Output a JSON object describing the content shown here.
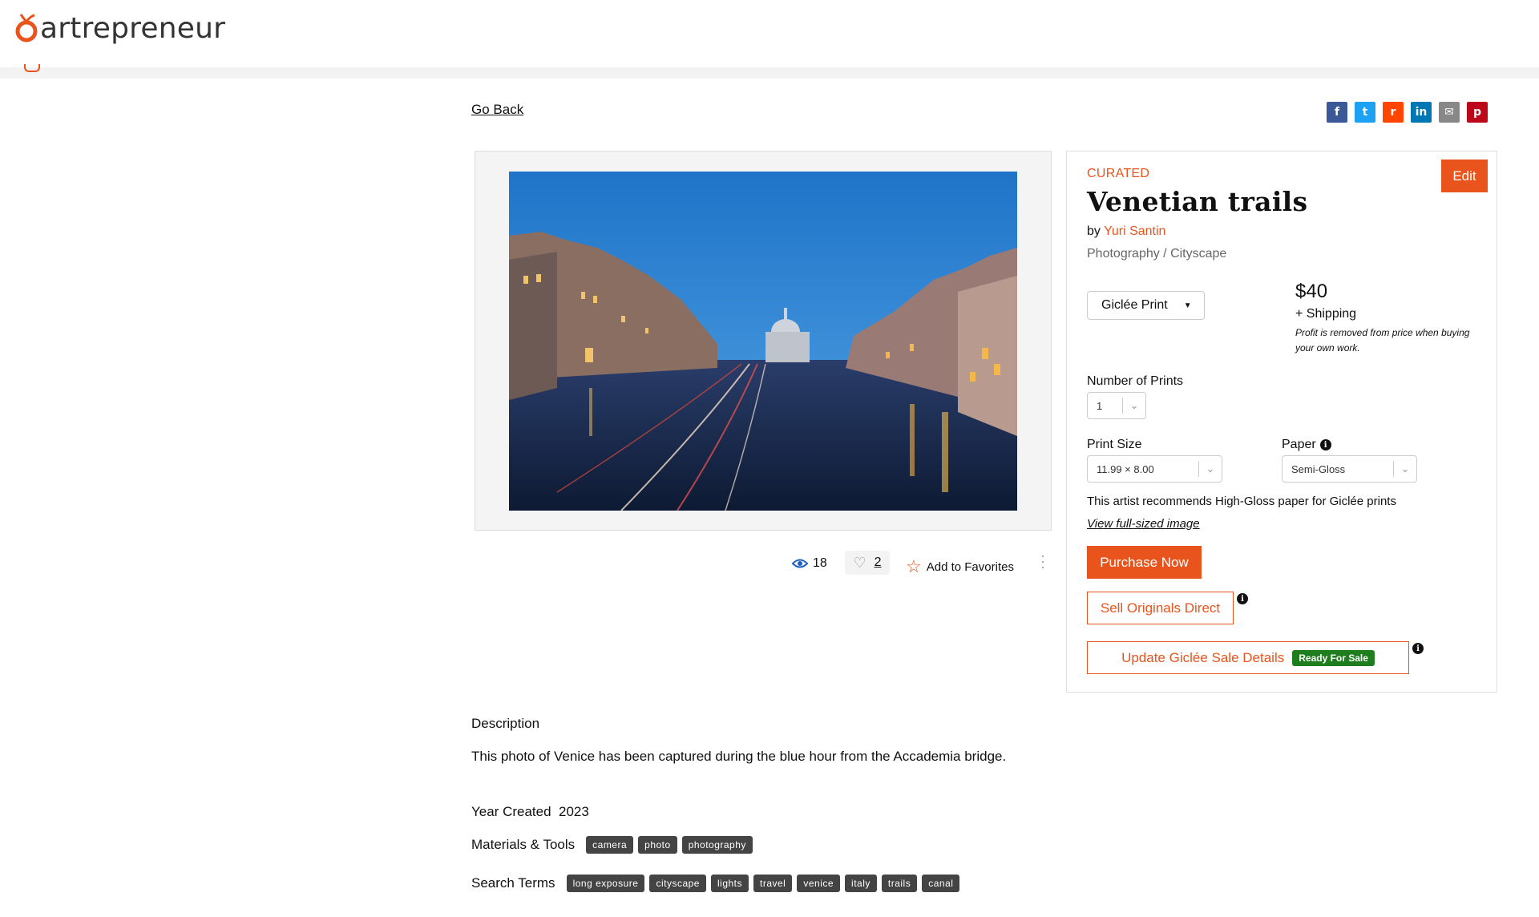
{
  "brand": {
    "name": "artrepreneur"
  },
  "nav": {
    "go_back": "Go Back"
  },
  "share": {
    "buttons": [
      {
        "name": "facebook-share-button",
        "glyph": "f",
        "color": "#3b5998"
      },
      {
        "name": "twitter-share-button",
        "glyph": "t",
        "color": "#1da1f2"
      },
      {
        "name": "reddit-share-button",
        "glyph": "r",
        "color": "#ff4500"
      },
      {
        "name": "linkedin-share-button",
        "glyph": "in",
        "color": "#0077b5"
      },
      {
        "name": "email-share-button",
        "glyph": "✉",
        "color": "#888888"
      },
      {
        "name": "pinterest-share-button",
        "glyph": "p",
        "color": "#bd081c"
      }
    ]
  },
  "artwork": {
    "views": "18",
    "likes": "2",
    "add_favorites": "Add to Favorites"
  },
  "info": {
    "badge": "CURATED",
    "edit_label": "Edit",
    "title": "Venetian trails",
    "by_prefix": "by",
    "artist": "Yuri Santin",
    "category": "Photography / Cityscape",
    "print_type": "Giclée Print",
    "price": "$40",
    "shipping": "+ Shipping",
    "profit_note": "Profit is removed from price when buying your own work.",
    "number_label": "Number of Prints",
    "number_value": "1",
    "size_label": "Print Size",
    "size_value": "11.99 × 8.00",
    "paper_label": "Paper",
    "paper_value": "Semi-Gloss",
    "recommend": "This artist recommends High-Gloss paper for Giclée prints",
    "view_full": "View full-sized image",
    "purchase": "Purchase Now",
    "sell_originals": "Sell Originals Direct",
    "update_giclee": "Update Giclée Sale Details",
    "ready_badge": "Ready For Sale"
  },
  "details": {
    "description_label": "Description",
    "description": "This photo of Venice has been captured during the blue hour from the Accademia bridge.",
    "year_label": "Year Created",
    "year": "2023",
    "materials_label": "Materials & Tools",
    "materials": [
      "camera",
      "photo",
      "photography"
    ],
    "search_label": "Search Terms",
    "search_terms": [
      "long exposure",
      "cityscape",
      "lights",
      "travel",
      "venice",
      "italy",
      "trails",
      "canal"
    ]
  },
  "colors": {
    "accent": "#e9541d",
    "ready": "#1e7e1e",
    "tag_bg": "#444444"
  }
}
